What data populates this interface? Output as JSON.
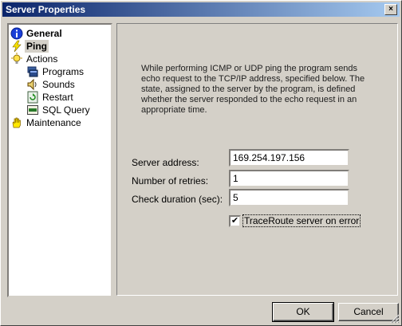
{
  "window": {
    "title": "Server Properties",
    "close_glyph": "×"
  },
  "tree": {
    "items": [
      {
        "label": "General",
        "icon": "info-icon"
      },
      {
        "label": "Ping",
        "icon": "lightning-icon"
      },
      {
        "label": "Actions",
        "icon": "lightbulb-icon"
      },
      {
        "label": "Programs",
        "icon": "programs-icon"
      },
      {
        "label": "Sounds",
        "icon": "speaker-icon"
      },
      {
        "label": "Restart",
        "icon": "restart-icon"
      },
      {
        "label": "SQL Query",
        "icon": "sql-icon"
      },
      {
        "label": "Maintenance",
        "icon": "hand-icon"
      }
    ]
  },
  "ping": {
    "description": "While performing ICMP or UDP ping the program sends echo request to the TCP/IP address, specified below. The state, assigned to the server by the program, is defined whether the server responded to the echo request in an appropriate time.",
    "server_address_label": "Server address:",
    "server_address_value": "169.254.197.156",
    "retries_label": "Number of retries:",
    "retries_value": "1",
    "duration_label": "Check duration (sec):",
    "duration_value": "5",
    "traceroute_label": "TraceRoute server on error",
    "traceroute_checked": true,
    "check_glyph": "✔"
  },
  "buttons": {
    "ok": "OK",
    "cancel": "Cancel"
  },
  "colors": {
    "title_start": "#0a246a",
    "title_end": "#a6caf0",
    "face": "#d4d0c8"
  }
}
